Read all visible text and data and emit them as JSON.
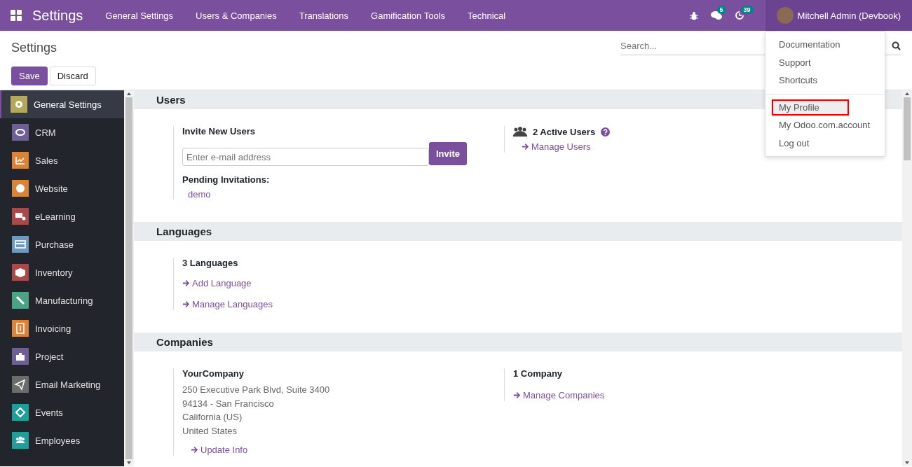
{
  "navbar": {
    "app_title": "Settings",
    "menu": [
      "General Settings",
      "Users & Companies",
      "Translations",
      "Gamification Tools",
      "Technical"
    ],
    "messages_badge": "5",
    "activities_badge": "39",
    "user_name": "Mitchell Admin (Devbook)"
  },
  "user_menu": {
    "items": [
      {
        "label": "Documentation",
        "selected": false,
        "kind": "item"
      },
      {
        "label": "Support",
        "selected": false,
        "kind": "item"
      },
      {
        "label": "Shortcuts",
        "selected": false,
        "kind": "item"
      },
      {
        "kind": "divider"
      },
      {
        "label": "My Profile",
        "selected": true,
        "kind": "item"
      },
      {
        "label": "My Odoo.com.account",
        "selected": false,
        "kind": "item"
      },
      {
        "label": "Log out",
        "selected": false,
        "kind": "item"
      }
    ]
  },
  "control_panel": {
    "title": "Settings",
    "search_placeholder": "Search...",
    "buttons": [
      "Save",
      "Discard"
    ]
  },
  "sidebar": {
    "items": [
      {
        "label": "General Settings",
        "selected": true,
        "color": "#b5a85a",
        "kind": "gear"
      },
      {
        "label": "CRM",
        "selected": false,
        "color": "#6f5f95",
        "kind": "handshake"
      },
      {
        "label": "Sales",
        "selected": false,
        "color": "#d9843a",
        "kind": "chart"
      },
      {
        "label": "Website",
        "selected": false,
        "color": "#d9843a",
        "kind": "globe"
      },
      {
        "label": "eLearning",
        "selected": false,
        "color": "#a84a4a",
        "kind": "screen"
      },
      {
        "label": "Purchase",
        "selected": false,
        "color": "#6d9ac0",
        "kind": "card"
      },
      {
        "label": "Inventory",
        "selected": false,
        "color": "#a84a4a",
        "kind": "box"
      },
      {
        "label": "Manufacturing",
        "selected": false,
        "color": "#4da184",
        "kind": "wrench"
      },
      {
        "label": "Invoicing",
        "selected": false,
        "color": "#d9843a",
        "kind": "doc"
      },
      {
        "label": "Project",
        "selected": false,
        "color": "#6f5f95",
        "kind": "puzzle"
      },
      {
        "label": "Email Marketing",
        "selected": false,
        "color": "#6b6d6b",
        "kind": "plane"
      },
      {
        "label": "Events",
        "selected": false,
        "color": "#1f9e9a",
        "kind": "ticket"
      },
      {
        "label": "Employees",
        "selected": false,
        "color": "#1f9e9a",
        "kind": "people"
      }
    ]
  },
  "users": {
    "title": "Users",
    "invite_label": "Invite New Users",
    "email_placeholder": "Enter e-mail address",
    "invite_button": "Invite",
    "pending_label": "Pending Invitations:",
    "pending": [
      "demo"
    ],
    "active_users": "2 Active Users",
    "manage_users": "Manage Users"
  },
  "languages": {
    "title": "Languages",
    "count": "3 Languages",
    "links": [
      "Add Language",
      "Manage Languages"
    ]
  },
  "companies": {
    "title": "Companies",
    "name": "YourCompany",
    "address": [
      "250 Executive Park Blvd, Suite 3400",
      "94134 - San Francisco",
      "California (US)",
      "United States"
    ],
    "update_link": "Update Info",
    "count": "1 Company",
    "manage_link": "Manage Companies"
  }
}
